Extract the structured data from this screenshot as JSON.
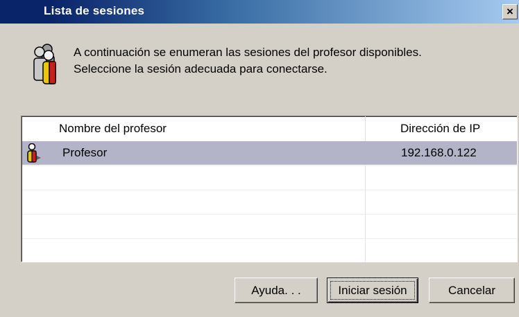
{
  "window": {
    "title": "Lista de sesiones",
    "close_label": "×"
  },
  "intro": {
    "line1": "A continuación se enumeran las sesiones del profesor disponibles.",
    "line2": "Seleccione la sesión adecuada para conectarse."
  },
  "list": {
    "columns": {
      "name": "Nombre del profesor",
      "ip": "Dirección de IP"
    },
    "rows": [
      {
        "name": "Profesor",
        "ip": "192.168.0.122",
        "selected": true,
        "icon": "teacher-icon"
      }
    ],
    "empty_rows": 4
  },
  "buttons": {
    "help": "Ayuda. . .",
    "login": "Iniciar sesión",
    "cancel": "Cancelar"
  },
  "colors": {
    "selection": "#b4b4c9",
    "titlebar_start": "#0a246a",
    "titlebar_end": "#a6caf0",
    "dialog_bg": "#d4d0c8"
  }
}
